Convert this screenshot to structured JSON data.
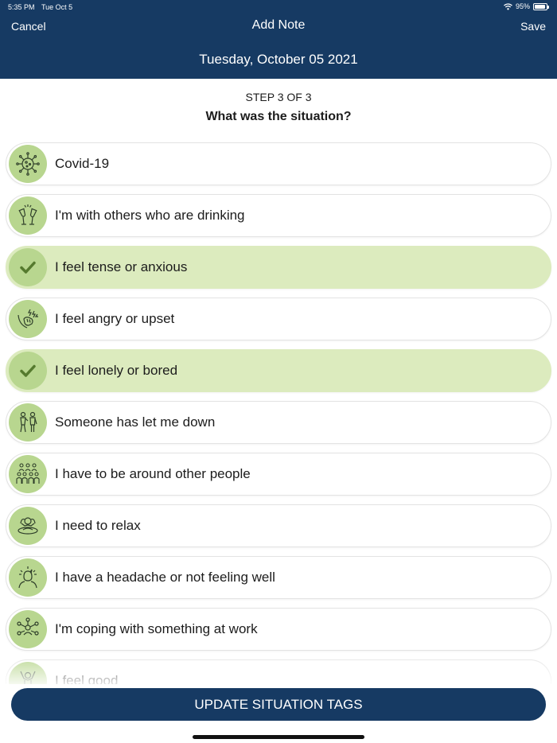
{
  "status_bar": {
    "time": "5:35 PM",
    "date": "Tue Oct 5",
    "battery": "95%",
    "battery_level": 0.95
  },
  "nav": {
    "cancel": "Cancel",
    "title": "Add Note",
    "save": "Save"
  },
  "date_title": "Tuesday, October 05 2021",
  "step": "STEP 3 OF 3",
  "question": "What was the situation?",
  "situations": [
    {
      "label": "Covid-19",
      "icon": "virus-icon",
      "selected": false
    },
    {
      "label": "I'm with others who are drinking",
      "icon": "wine-glasses-icon",
      "selected": false
    },
    {
      "label": "I feel tense or anxious",
      "icon": "check-icon",
      "selected": true
    },
    {
      "label": "I feel angry or upset",
      "icon": "angry-fist-icon",
      "selected": false
    },
    {
      "label": "I feel lonely or bored",
      "icon": "check-icon",
      "selected": true
    },
    {
      "label": "Someone has let me down",
      "icon": "people-turned-away-icon",
      "selected": false
    },
    {
      "label": "I have to be around other people",
      "icon": "crowd-icon",
      "selected": false
    },
    {
      "label": "I need to relax",
      "icon": "relaxing-person-icon",
      "selected": false
    },
    {
      "label": "I have a headache or not feeling well",
      "icon": "headache-icon",
      "selected": false
    },
    {
      "label": "I'm coping with something at work",
      "icon": "work-network-icon",
      "selected": false
    },
    {
      "label": "I feel good",
      "icon": "happy-person-icon",
      "selected": false
    }
  ],
  "update_button": "UPDATE SITUATION TAGS",
  "colors": {
    "header": "#163a63",
    "selected_row": "#dcebbe",
    "icon_bg": "#b8d68f",
    "check": "#557a2e",
    "icon_line": "#2f3f2a"
  }
}
